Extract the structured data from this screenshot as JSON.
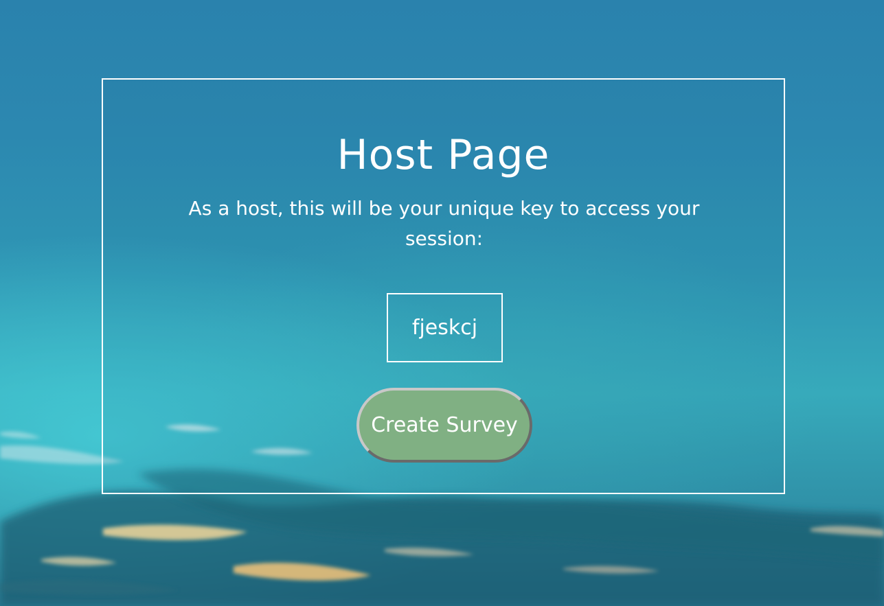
{
  "page": {
    "title": "Host Page",
    "subtitle": "As a host, this will be your unique key to access your session:",
    "session_key": "fjeskcj",
    "create_button_label": "Create Survey"
  },
  "colors": {
    "sky_top": "#2a82ad",
    "sky_mid": "#37aabb",
    "button_fill": "#80b083",
    "border": "#ffffff",
    "text": "#ffffff"
  }
}
